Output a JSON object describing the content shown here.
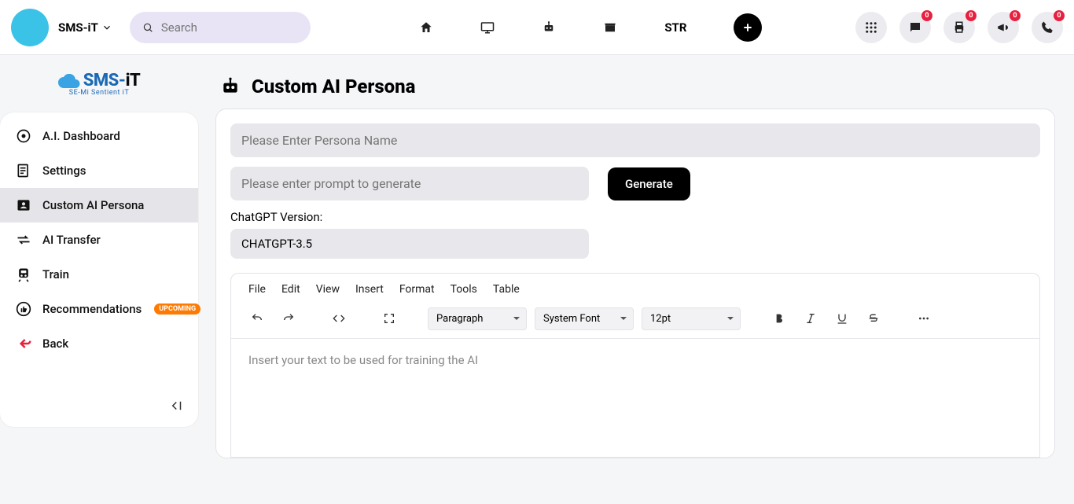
{
  "header": {
    "brand": "SMS-iT",
    "search_placeholder": "Search",
    "nav_str_label": "STR",
    "badges": {
      "chat": "0",
      "print": "0",
      "announce": "0",
      "phone": "0"
    }
  },
  "sidebar": {
    "logo": {
      "primary": "SMS-iT",
      "tagline": "SE-Mi Sentient iT"
    },
    "items": [
      {
        "label": "A.I. Dashboard"
      },
      {
        "label": "Settings"
      },
      {
        "label": "Custom AI Persona"
      },
      {
        "label": "AI Transfer"
      },
      {
        "label": "Train"
      },
      {
        "label": "Recommendations",
        "badge": "UPCOMING"
      },
      {
        "label": "Back"
      }
    ]
  },
  "page": {
    "title": "Custom AI Persona",
    "persona_name_placeholder": "Please Enter Persona Name",
    "prompt_placeholder": "Please enter prompt to generate",
    "generate_label": "Generate",
    "version_label": "ChatGPT Version:",
    "version_value": "CHATGPT-3.5"
  },
  "editor": {
    "menu": [
      "File",
      "Edit",
      "View",
      "Insert",
      "Format",
      "Tools",
      "Table"
    ],
    "paragraph": "Paragraph",
    "font": "System Font",
    "size": "12pt",
    "body_placeholder": "Insert your text to be used for training the AI"
  }
}
